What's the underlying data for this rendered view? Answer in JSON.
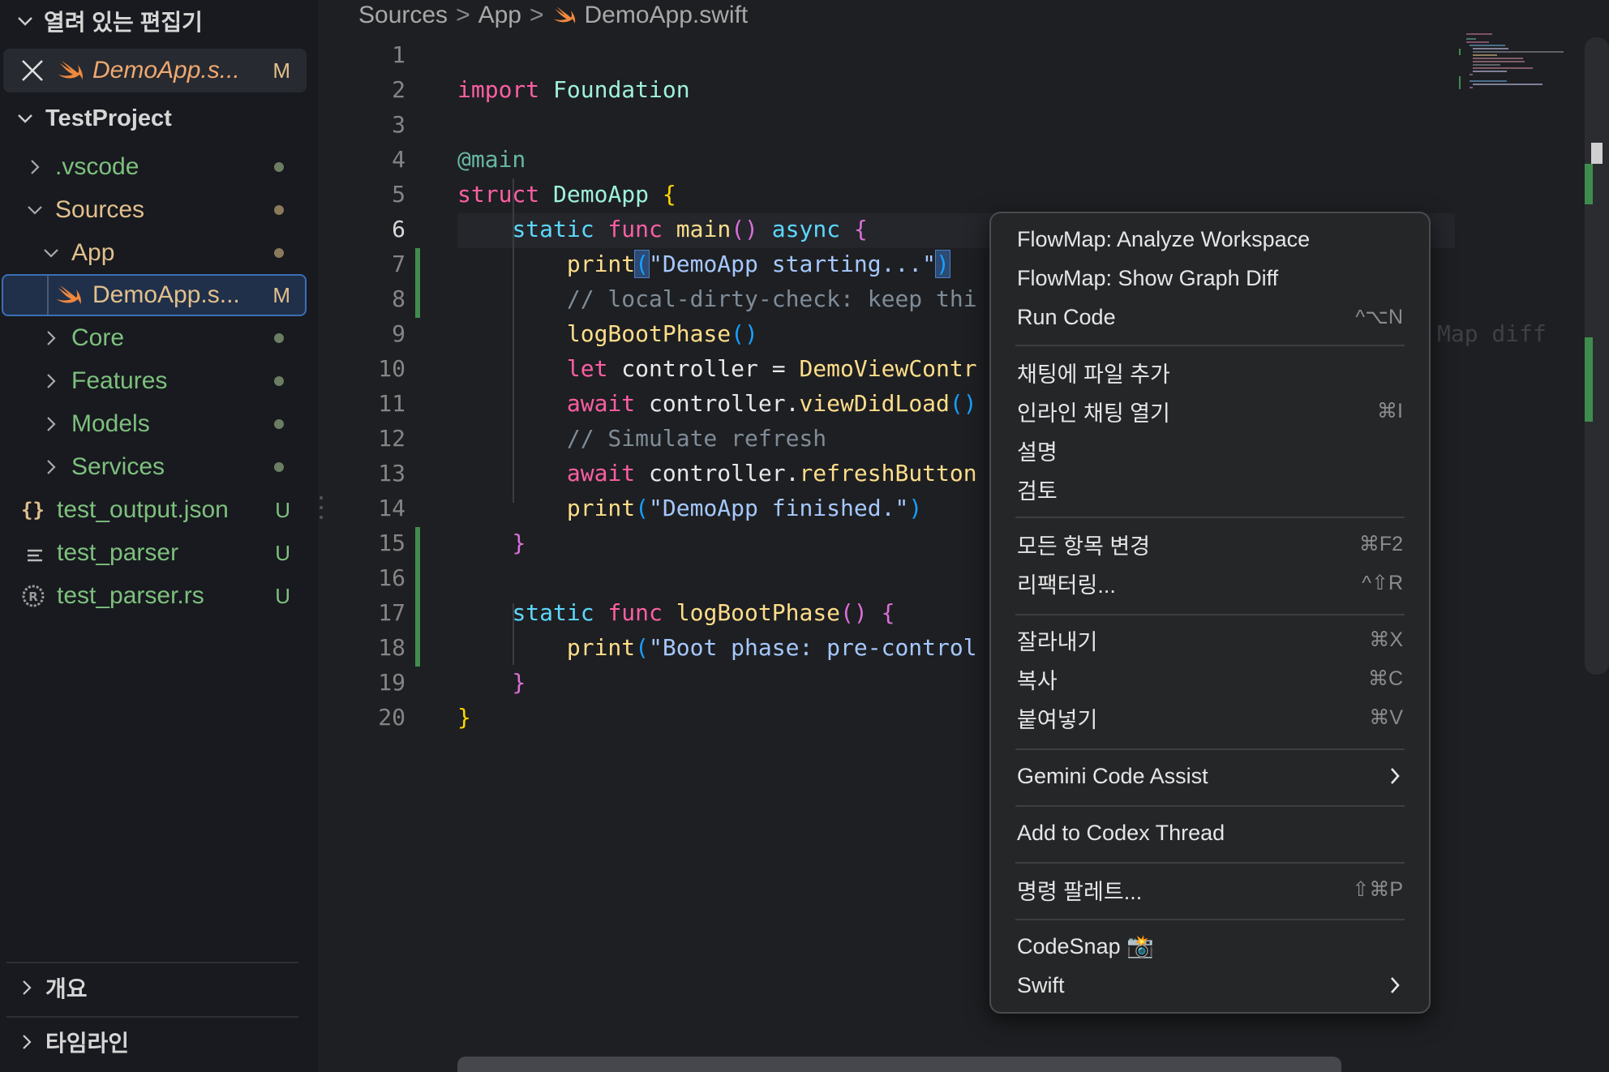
{
  "sidebar": {
    "open_editors_title": "열려 있는 편집기",
    "open_editor": {
      "name": "DemoApp.s...",
      "status": "M"
    },
    "project_title": "TestProject",
    "tree": [
      {
        "label": ".vscode",
        "status": "dot"
      },
      {
        "label": "Sources",
        "status": "dot"
      },
      {
        "label": "App",
        "status": "dot"
      },
      {
        "label": "DemoApp.s...",
        "status": "M"
      },
      {
        "label": "Core",
        "status": "dot"
      },
      {
        "label": "Features",
        "status": "dot"
      },
      {
        "label": "Models",
        "status": "dot"
      },
      {
        "label": "Services",
        "status": "dot"
      },
      {
        "label": "test_output.json",
        "status": "U"
      },
      {
        "label": "test_parser",
        "status": "U"
      },
      {
        "label": "test_parser.rs",
        "status": "U"
      }
    ],
    "outline_title": "개요",
    "timeline_title": "타임라인"
  },
  "breadcrumb": [
    "Sources",
    "App",
    "DemoApp.swift"
  ],
  "editor": {
    "line_numbers": [
      "1",
      "2",
      "3",
      "4",
      "5",
      "6",
      "7",
      "8",
      "9",
      "10",
      "11",
      "12",
      "13",
      "14",
      "15",
      "16",
      "17",
      "18",
      "19",
      "20"
    ],
    "active_line": "6",
    "code": {
      "l1": [
        "import",
        "Foundation"
      ],
      "l3": [
        "@main"
      ],
      "l4": [
        "struct",
        "DemoApp",
        "{"
      ],
      "l5": [
        "static",
        "func",
        "main",
        "()",
        "async",
        "{"
      ],
      "l6": [
        "print",
        "(",
        "\"DemoApp starting...\"",
        ")"
      ],
      "l7": [
        "// local-dirty-check: keep thi"
      ],
      "l7_ghost": "Map diff",
      "l8": [
        "logBootPhase",
        "()"
      ],
      "l9": [
        "let",
        "controller",
        "=",
        "DemoViewContr"
      ],
      "l10": [
        "await",
        "controller.",
        "viewDidLoad",
        "()"
      ],
      "l11": [
        "// Simulate refresh"
      ],
      "l12": [
        "await",
        "controller.",
        "refreshButton"
      ],
      "l13": [
        "print",
        "(",
        "\"DemoApp finished.\"",
        ")"
      ],
      "l14": [
        "}"
      ],
      "l16": [
        "static",
        "func",
        "logBootPhase",
        "()",
        "{"
      ],
      "l17": [
        "print",
        "(",
        "\"Boot phase: pre-control"
      ],
      "l18": [
        "}"
      ],
      "l19": [
        "}"
      ]
    }
  },
  "context_menu": {
    "items": [
      {
        "label": "FlowMap: Analyze Workspace",
        "shortcut": ""
      },
      {
        "label": "FlowMap: Show Graph Diff",
        "shortcut": ""
      },
      {
        "label": "Run Code",
        "shortcut": "^⌥N"
      },
      {
        "label": "채팅에 파일 추가",
        "shortcut": ""
      },
      {
        "label": "인라인 채팅 열기",
        "shortcut": "⌘I"
      },
      {
        "label": "설명",
        "shortcut": ""
      },
      {
        "label": "검토",
        "shortcut": ""
      },
      {
        "label": "모든 항목 변경",
        "shortcut": "⌘F2"
      },
      {
        "label": "리팩터링...",
        "shortcut": "^⇧R"
      },
      {
        "label": "잘라내기",
        "shortcut": "⌘X"
      },
      {
        "label": "복사",
        "shortcut": "⌘C"
      },
      {
        "label": "붙여넣기",
        "shortcut": "⌘V"
      },
      {
        "label": "Gemini Code Assist",
        "shortcut": ""
      },
      {
        "label": "Add to Codex Thread",
        "shortcut": ""
      },
      {
        "label": "명령 팔레트...",
        "shortcut": "⇧⌘P"
      },
      {
        "label": "CodeSnap 📸",
        "shortcut": ""
      },
      {
        "label": "Swift",
        "shortcut": ""
      }
    ]
  },
  "colors": {
    "added_status": "#7ec07e",
    "folder_dot": "#6b7d62",
    "swift_orange": "#f0883e",
    "selection_border": "#3b6fb5"
  },
  "icons": [
    "chevron-down-icon",
    "chevron-right-icon",
    "close-icon",
    "swift-file-icon",
    "json-file-icon",
    "text-file-icon",
    "rust-file-icon",
    "submenu-chevron-icon"
  ]
}
